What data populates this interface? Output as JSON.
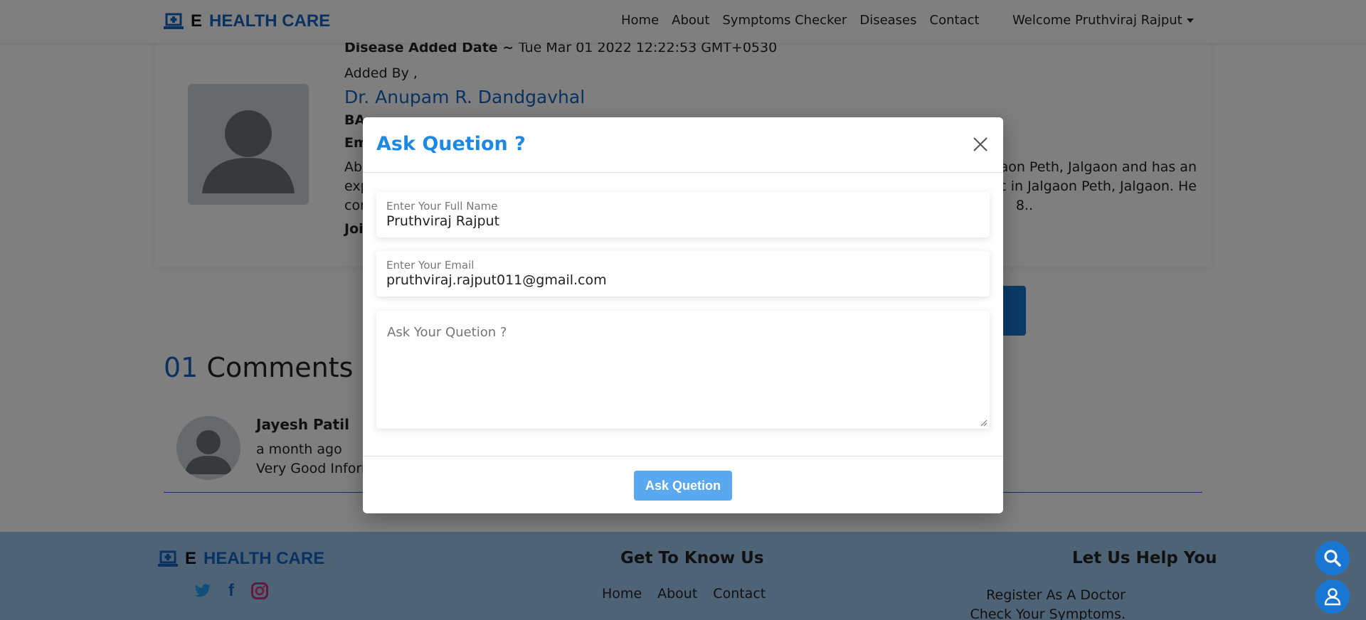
{
  "brand": {
    "prefix": "E",
    "name": "HEALTH CARE"
  },
  "nav": {
    "links": [
      "Home",
      "About",
      "Symptoms Checker",
      "Diseases",
      "Contact"
    ],
    "user": "Welcome Pruthviraj Rajput"
  },
  "doctor_card": {
    "date_label": "Disease Added Date ~",
    "date_value": "Tue Mar 01 2022 12:22:53 GMT+0530",
    "added_by": "Added By ,",
    "doctor_name": "Dr. Anupam R. Dandgavhal",
    "degree": "BA",
    "email_prefix": "Em",
    "about_prefix": "Ab",
    "about_line1_end": "aon Peth, Jalgaon and has an",
    "about_line2_prefix": "exp",
    "about_line2_end": "c in Jalgaon Peth, Jalgaon. He",
    "about_line3_prefix": "con",
    "about_line3_end": "8..",
    "joined_prefix": "Joi"
  },
  "comments": {
    "count": "01",
    "title": "Comments",
    "items": [
      {
        "name": "Jayesh Patil",
        "time": "a month ago",
        "text": "Very Good Inform"
      }
    ]
  },
  "footer": {
    "col2_title": "Get To Know Us",
    "col2_links": [
      "Home",
      "About",
      "Contact"
    ],
    "col3_title": "Let Us Help You",
    "col3_links": [
      "Register As A Doctor",
      "Check Your Symptoms."
    ]
  },
  "modal": {
    "title": "Ask Quetion ?",
    "name_label": "Enter Your Full Name",
    "name_value": "Pruthviraj Rajput",
    "email_label": "Enter Your Email",
    "email_value": "pruthviraj.rajput011@gmail.com",
    "question_placeholder": "Ask Your Quetion ?",
    "submit_label": "Ask Quetion"
  },
  "colors": {
    "brand_blue": "#1565c0",
    "modal_title": "#1e88e5",
    "button": "#5aa9f0"
  },
  "icons": [
    "laptop-medical-icon",
    "close-icon",
    "twitter-icon",
    "facebook-icon",
    "instagram-icon",
    "search-icon",
    "user-doctor-icon",
    "caret-down-icon"
  ]
}
